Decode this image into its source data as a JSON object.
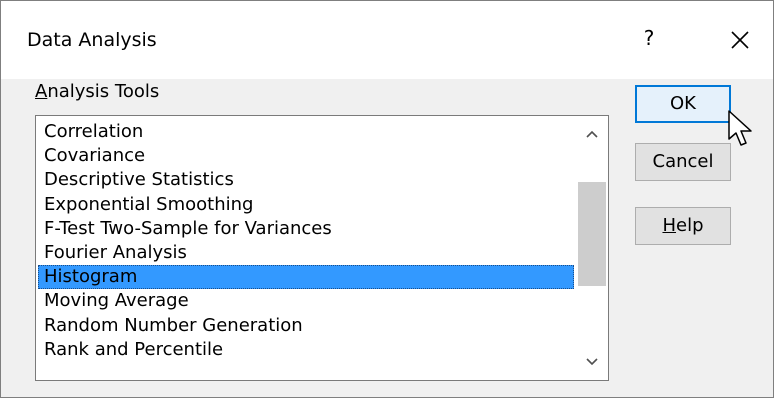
{
  "window": {
    "title": "Data Analysis",
    "help_label": "?",
    "close_icon": "close-icon"
  },
  "group": {
    "label_mnemonic": "A",
    "label_rest": "nalysis Tools"
  },
  "tools": [
    "Correlation",
    "Covariance",
    "Descriptive Statistics",
    "Exponential Smoothing",
    "F-Test Two-Sample for Variances",
    "Fourier Analysis",
    "Histogram",
    "Moving Average",
    "Random Number Generation",
    "Rank and Percentile"
  ],
  "selected_tool": "Histogram",
  "buttons": {
    "ok": "OK",
    "cancel": "Cancel",
    "help_mnemonic": "H",
    "help_rest": "elp"
  },
  "colors": {
    "selection": "#3399ff",
    "default_button_border": "#0078d7",
    "dialog_background": "#f0f0f0"
  }
}
